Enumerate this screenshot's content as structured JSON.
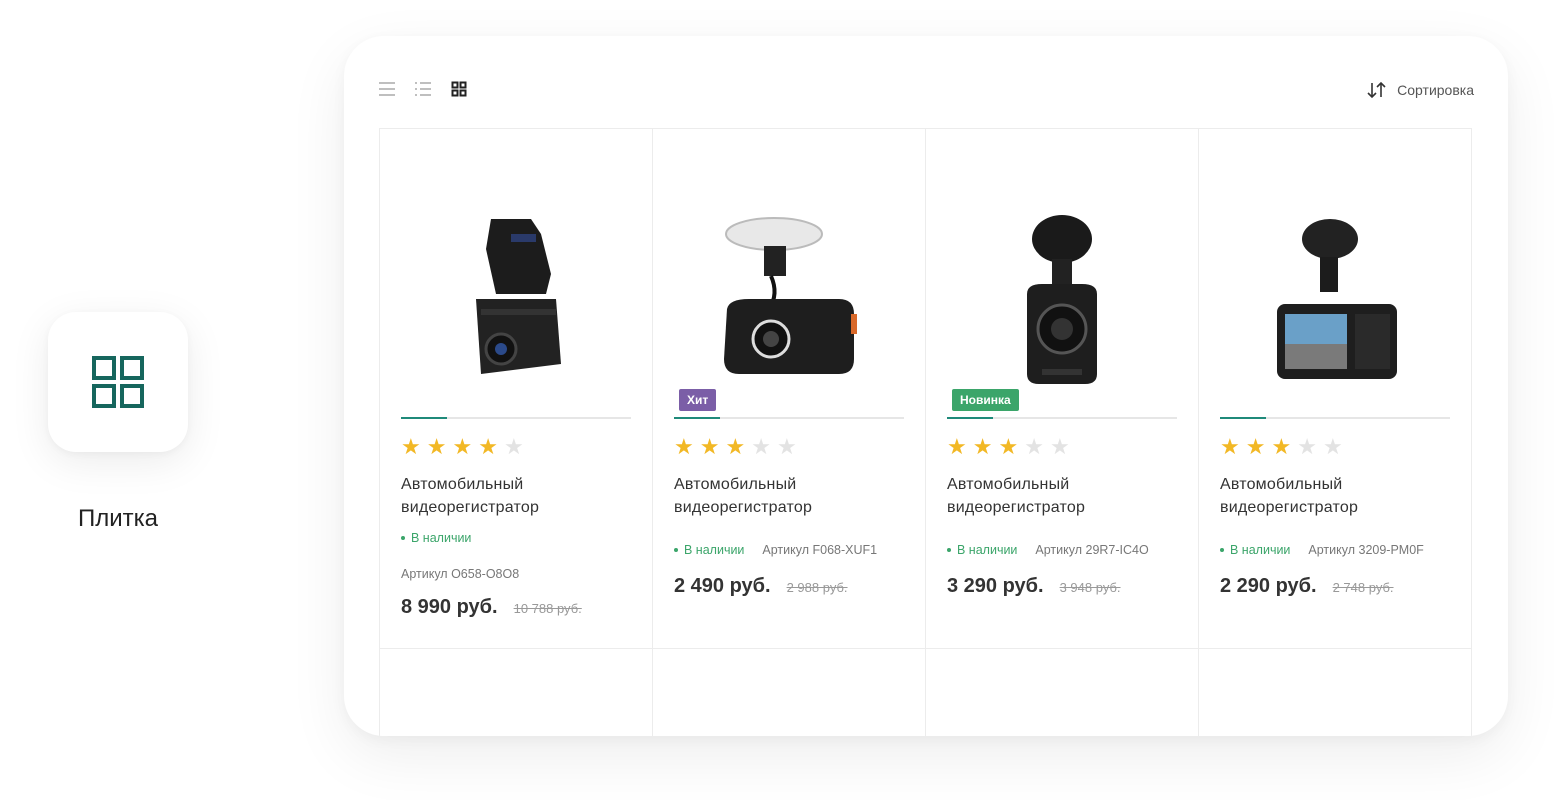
{
  "feature": {
    "label": "Плитка",
    "icon": "tile-grid-icon",
    "color": "#16665d"
  },
  "toolbar": {
    "views": [
      "list-view-icon",
      "compact-list-view-icon",
      "tile-view-icon"
    ],
    "active_view": "tile-view-icon",
    "sort_label": "Сортировка"
  },
  "products": [
    {
      "title": "Автомобильный видеорегистратор",
      "rating": 4,
      "stock": "В наличии",
      "sku": "Артикул O658-O8O8",
      "price": "8 990 руб.",
      "old_price": "10 788 руб.",
      "badge": "",
      "image_progress": 0.2
    },
    {
      "title": "Автомобильный видеорегистратор",
      "rating": 3,
      "stock": "В наличии",
      "sku": "Артикул F068-XUF1",
      "price": "2 490 руб.",
      "old_price": "2 988 руб.",
      "badge": "Хит",
      "image_progress": 0.2
    },
    {
      "title": "Автомобильный видеорегистратор",
      "rating": 3,
      "stock": "В наличии",
      "sku": "Артикул 29R7-IC4O",
      "price": "3 290 руб.",
      "old_price": "3 948 руб.",
      "badge": "Новинка",
      "image_progress": 0.2
    },
    {
      "title": "Автомобильный видеорегистратор",
      "rating": 3,
      "stock": "В наличии",
      "sku": "Артикул 3209-PM0F",
      "price": "2 290 руб.",
      "old_price": "2 748 руб.",
      "badge": "",
      "image_progress": 0.2
    }
  ],
  "colors": {
    "accent": "#1f8a7a",
    "star": "#f2b825",
    "in_stock": "#3ba56a",
    "badge_hit": "#7b5ea7",
    "badge_new": "#3ba56a"
  }
}
